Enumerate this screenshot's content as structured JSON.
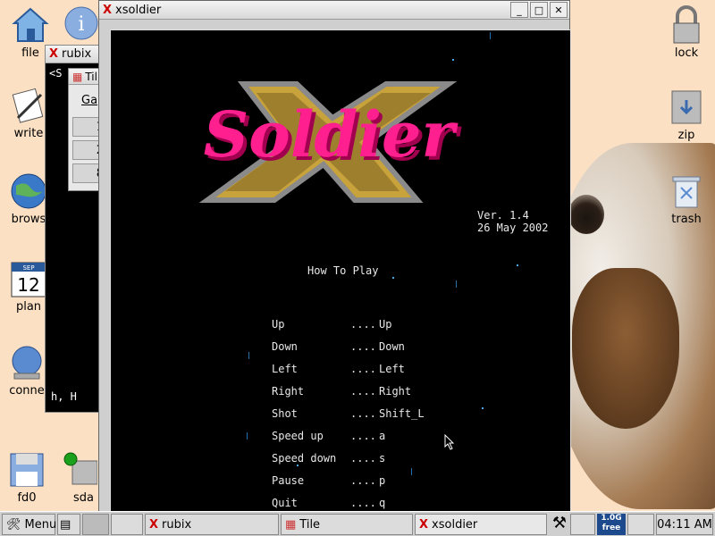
{
  "desktop": {
    "icons": [
      {
        "label": "file"
      },
      {
        "label": "write"
      },
      {
        "label": "brows"
      },
      {
        "label": "plan"
      },
      {
        "label": "conne"
      },
      {
        "label": "fd0"
      },
      {
        "label": "sda"
      },
      {
        "label": "lock"
      },
      {
        "label": "zip"
      },
      {
        "label": "trash"
      }
    ],
    "plan_day": "12",
    "plan_month": "SEP"
  },
  "rubix_window": {
    "title": "rubix",
    "body_top": "<S",
    "body_bottom": "h, H"
  },
  "tile_window": {
    "title": "Til",
    "menu": "Ga",
    "buttons": [
      "1",
      "2",
      "8"
    ]
  },
  "xsoldier_window": {
    "title": "xsoldier",
    "logo_word": "Soldier",
    "logo_letter": "X",
    "version": "Ver. 1.4",
    "date": "26 May 2002",
    "how_to_play": "How To Play",
    "controls": [
      {
        "action": "Up",
        "dots": "....",
        "key": "Up"
      },
      {
        "action": "Down",
        "dots": "....",
        "key": "Down"
      },
      {
        "action": "Left",
        "dots": "....",
        "key": "Left"
      },
      {
        "action": "Right",
        "dots": "....",
        "key": "Right"
      },
      {
        "action": "Shot",
        "dots": "....",
        "key": "Shift_L"
      },
      {
        "action": "Speed up",
        "dots": "....",
        "key": "a"
      },
      {
        "action": "Speed down",
        "dots": "....",
        "key": "s"
      },
      {
        "action": "Pause",
        "dots": "....",
        "key": "p"
      },
      {
        "action": "Quit",
        "dots": "....",
        "key": "q"
      }
    ]
  },
  "taskbar": {
    "menu_label": "Menu",
    "tasks": [
      {
        "label": "rubix"
      },
      {
        "label": "Tile"
      },
      {
        "label": "xsoldier"
      }
    ],
    "free_line1": "1.0G",
    "free_line2": "free",
    "clock": "04:11 AM"
  },
  "colors": {
    "logo_pink": "#ff1f8e",
    "logo_gold": "#c8a23a",
    "desktop_bg": "#fbe0c4",
    "x_red": "#cc0000"
  }
}
